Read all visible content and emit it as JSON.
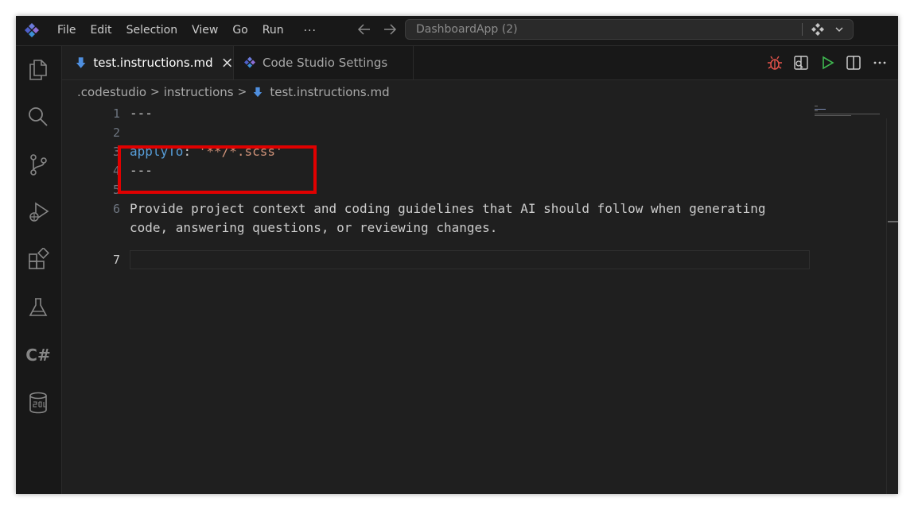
{
  "menu": {
    "file": "File",
    "edit": "Edit",
    "selection": "Selection",
    "view": "View",
    "go": "Go",
    "run": "Run",
    "more": "···"
  },
  "command_center": {
    "text": "DashboardApp (2)"
  },
  "activity_bar": {
    "csharp_label": "C#"
  },
  "tabs": [
    {
      "label": "test.instructions.md",
      "active": true
    },
    {
      "label": "Code Studio Settings",
      "active": false
    }
  ],
  "breadcrumb": {
    "part1": ".codestudio",
    "part2": "instructions",
    "part3": "test.instructions.md",
    "separator": ">"
  },
  "editor": {
    "line_numbers": [
      "1",
      "2",
      "3",
      "4",
      "5",
      "6",
      "7"
    ],
    "line1": "---",
    "line3_key": "applyTo",
    "line3_colon": ": ",
    "line3_value": "'**/*.scss'",
    "line4": "---",
    "line6a": "Provide project context and coding guidelines that AI should follow when generating",
    "line6b": "code, answering questions, or reviewing changes."
  },
  "colors": {
    "background": "#1f1f1f",
    "chrome": "#181818",
    "key": "#569cd6",
    "string": "#ce9178",
    "highlight": "#e00000",
    "accent": "#4f8fdf"
  }
}
